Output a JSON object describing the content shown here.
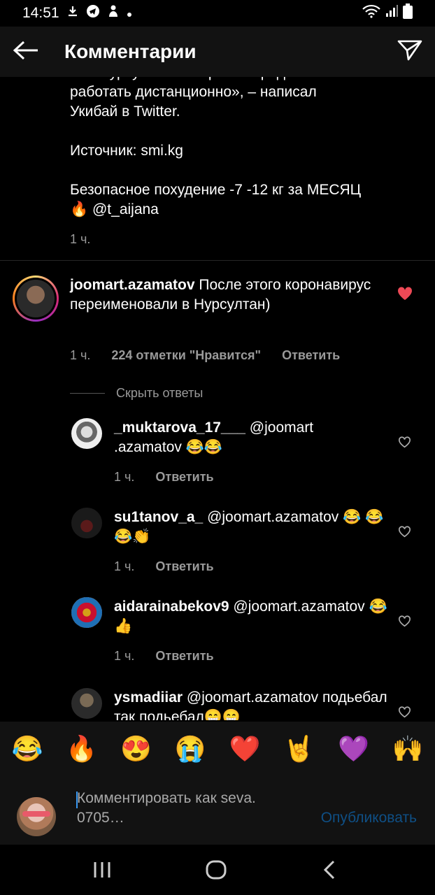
{
  "status": {
    "time": "14:51"
  },
  "header": {
    "title": "Комментарии"
  },
  "caption": {
    "text": "нет. Нурсултан Назарбаев продолжает\nработать дистанционно», – написал\nУкибай в Twitter.\n\nИсточник: smi.kg\n\nБезопасное похудение -7 -12 кг за МЕСЯЦ\n🔥 @t_aijana",
    "time": "1 ч."
  },
  "main_comment": {
    "username": "joomart.azamatov",
    "text": " После этого коронавирус переименовали в Нурсултан)",
    "time": "1 ч.",
    "likes": "224 отметки \"Нравится\"",
    "reply": "Ответить",
    "hide_replies": "Скрыть ответы"
  },
  "replies": [
    {
      "username": "_muktarova_17___",
      "text": " @joomart .azamatov 😂😂",
      "time": "1 ч.",
      "reply": "Ответить"
    },
    {
      "username": "su1tanov_a_",
      "text": " @joomart.azamatov 😂 😂😂👏",
      "time": "1 ч.",
      "reply": "Ответить"
    },
    {
      "username": "aidarainabekov9",
      "text": " @joomart.azamatov 😂👍",
      "time": "1 ч.",
      "reply": "Ответить"
    },
    {
      "username": "ysmadiiar",
      "text": " @joomart.azamatov подьебал так подьебал😁😁",
      "time": "",
      "reply": ""
    }
  ],
  "emoji_bar": [
    "😂",
    "🔥",
    "😍",
    "😭",
    "❤️",
    "🤘",
    "💜",
    "🙌"
  ],
  "composer": {
    "placeholder": "Комментировать как seva.\n0705…",
    "publish": "Опубликовать"
  },
  "colors": {
    "like_red": "#ed4956",
    "publish_blue": "#0f4f85",
    "bar_bg": "#121212"
  }
}
